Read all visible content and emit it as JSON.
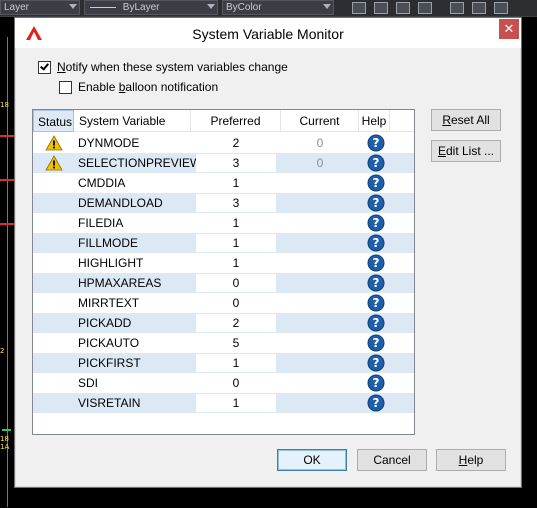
{
  "background": {
    "layer_combo_label": "Layer",
    "linetype_combo_label": "ByLayer",
    "color_combo_label": "ByColor",
    "side_marks": [
      "18",
      "2",
      "18",
      "1A"
    ]
  },
  "dialog": {
    "title": "System Variable Monitor",
    "close_glyph": "✕",
    "notify_label_prefix": "",
    "notify_label_accel": "N",
    "notify_label_rest": "otify when these system variables change",
    "notify_checked": true,
    "balloon_label_prefix": "Enable ",
    "balloon_label_accel": "b",
    "balloon_label_rest": "alloon notification",
    "balloon_checked": false,
    "columns": {
      "status": "Status",
      "variable": "System Variable",
      "preferred": "Preferred",
      "current": "Current",
      "help": "Help"
    },
    "rows": [
      {
        "status": "warning",
        "name": "DYNMODE",
        "preferred": "2",
        "current": "0"
      },
      {
        "status": "warning",
        "name": "SELECTIONPREVIEW",
        "preferred": "3",
        "current": "0"
      },
      {
        "status": "",
        "name": "CMDDIA",
        "preferred": "1",
        "current": ""
      },
      {
        "status": "",
        "name": "DEMANDLOAD",
        "preferred": "3",
        "current": ""
      },
      {
        "status": "",
        "name": "FILEDIA",
        "preferred": "1",
        "current": ""
      },
      {
        "status": "",
        "name": "FILLMODE",
        "preferred": "1",
        "current": ""
      },
      {
        "status": "",
        "name": "HIGHLIGHT",
        "preferred": "1",
        "current": ""
      },
      {
        "status": "",
        "name": "HPMAXAREAS",
        "preferred": "0",
        "current": ""
      },
      {
        "status": "",
        "name": "MIRRTEXT",
        "preferred": "0",
        "current": ""
      },
      {
        "status": "",
        "name": "PICKADD",
        "preferred": "2",
        "current": ""
      },
      {
        "status": "",
        "name": "PICKAUTO",
        "preferred": "5",
        "current": ""
      },
      {
        "status": "",
        "name": "PICKFIRST",
        "preferred": "1",
        "current": ""
      },
      {
        "status": "",
        "name": "SDI",
        "preferred": "0",
        "current": ""
      },
      {
        "status": "",
        "name": "VISRETAIN",
        "preferred": "1",
        "current": ""
      }
    ],
    "reset_all_prefix": "",
    "reset_all_accel": "R",
    "reset_all_rest": "eset All",
    "edit_list_prefix": "",
    "edit_list_accel": "E",
    "edit_list_rest": "dit List ...",
    "ok_label": "OK",
    "cancel_label": "Cancel",
    "help_prefix": "",
    "help_accel": "H",
    "help_rest": "elp",
    "colors": {
      "alt_row": "#dde8f5",
      "help_icon": "#1f5fa9",
      "warning_icon": "#f2c200",
      "close_button": "#c75050"
    }
  }
}
